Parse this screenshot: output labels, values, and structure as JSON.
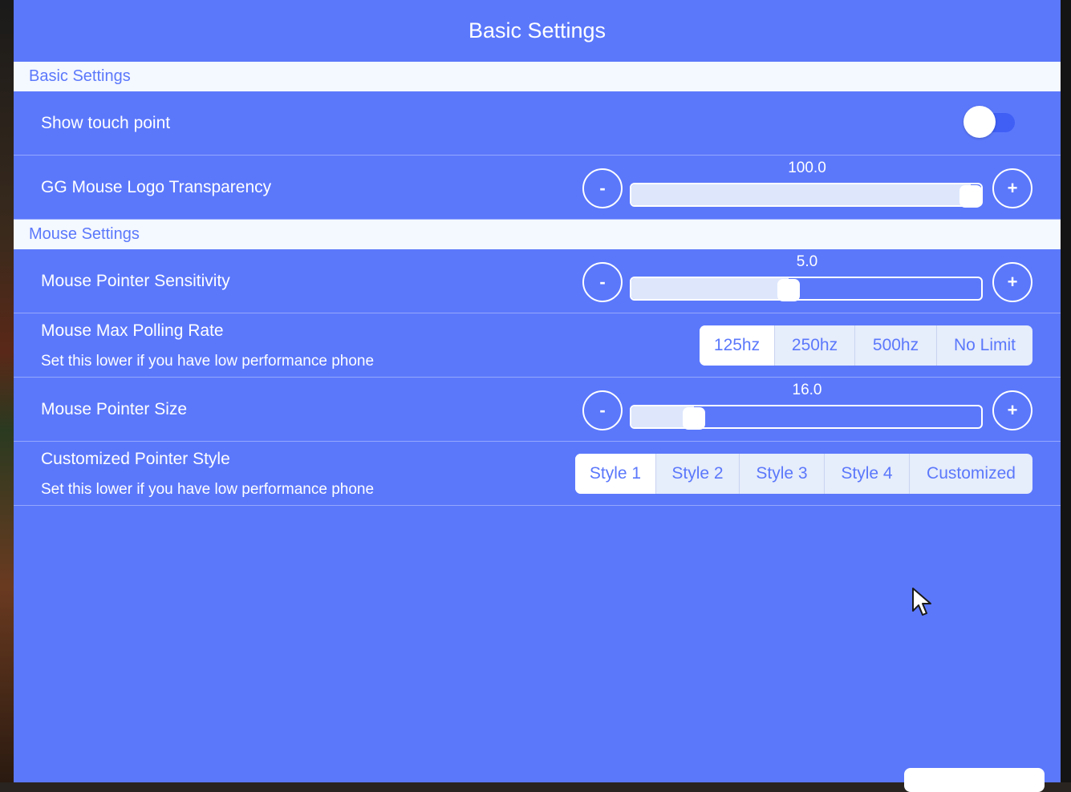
{
  "header": {
    "title": "Basic Settings"
  },
  "sections": {
    "basic": "Basic Settings",
    "mouse": "Mouse Settings"
  },
  "rows": {
    "show_touch_point": {
      "label": "Show touch point",
      "enabled": true
    },
    "logo_transparency": {
      "label": "GG Mouse Logo Transparency",
      "value": "100.0",
      "fraction": 0.97
    },
    "pointer_sensitivity": {
      "label": "Mouse Pointer Sensitivity",
      "value": "5.0",
      "fraction": 0.45
    },
    "polling_rate": {
      "label": "Mouse Max Polling Rate",
      "hint": "Set this lower if you have low performance phone",
      "options": [
        "125hz",
        "250hz",
        "500hz",
        "No Limit"
      ],
      "selected": "125hz"
    },
    "pointer_size": {
      "label": "Mouse Pointer Size",
      "value": "16.0",
      "fraction": 0.18
    },
    "pointer_style": {
      "label": "Customized Pointer Style",
      "hint": "Set this lower if you have low performance phone",
      "options": [
        "Style 1",
        "Style 2",
        "Style 3",
        "Style 4",
        "Customized"
      ],
      "selected": "Style 1"
    }
  },
  "buttons": {
    "minus": "-",
    "plus": "+"
  },
  "colors": {
    "panel": "#5b78fb",
    "section_bg": "#f4f8ff",
    "toggle_on": "#3f5ff5"
  }
}
